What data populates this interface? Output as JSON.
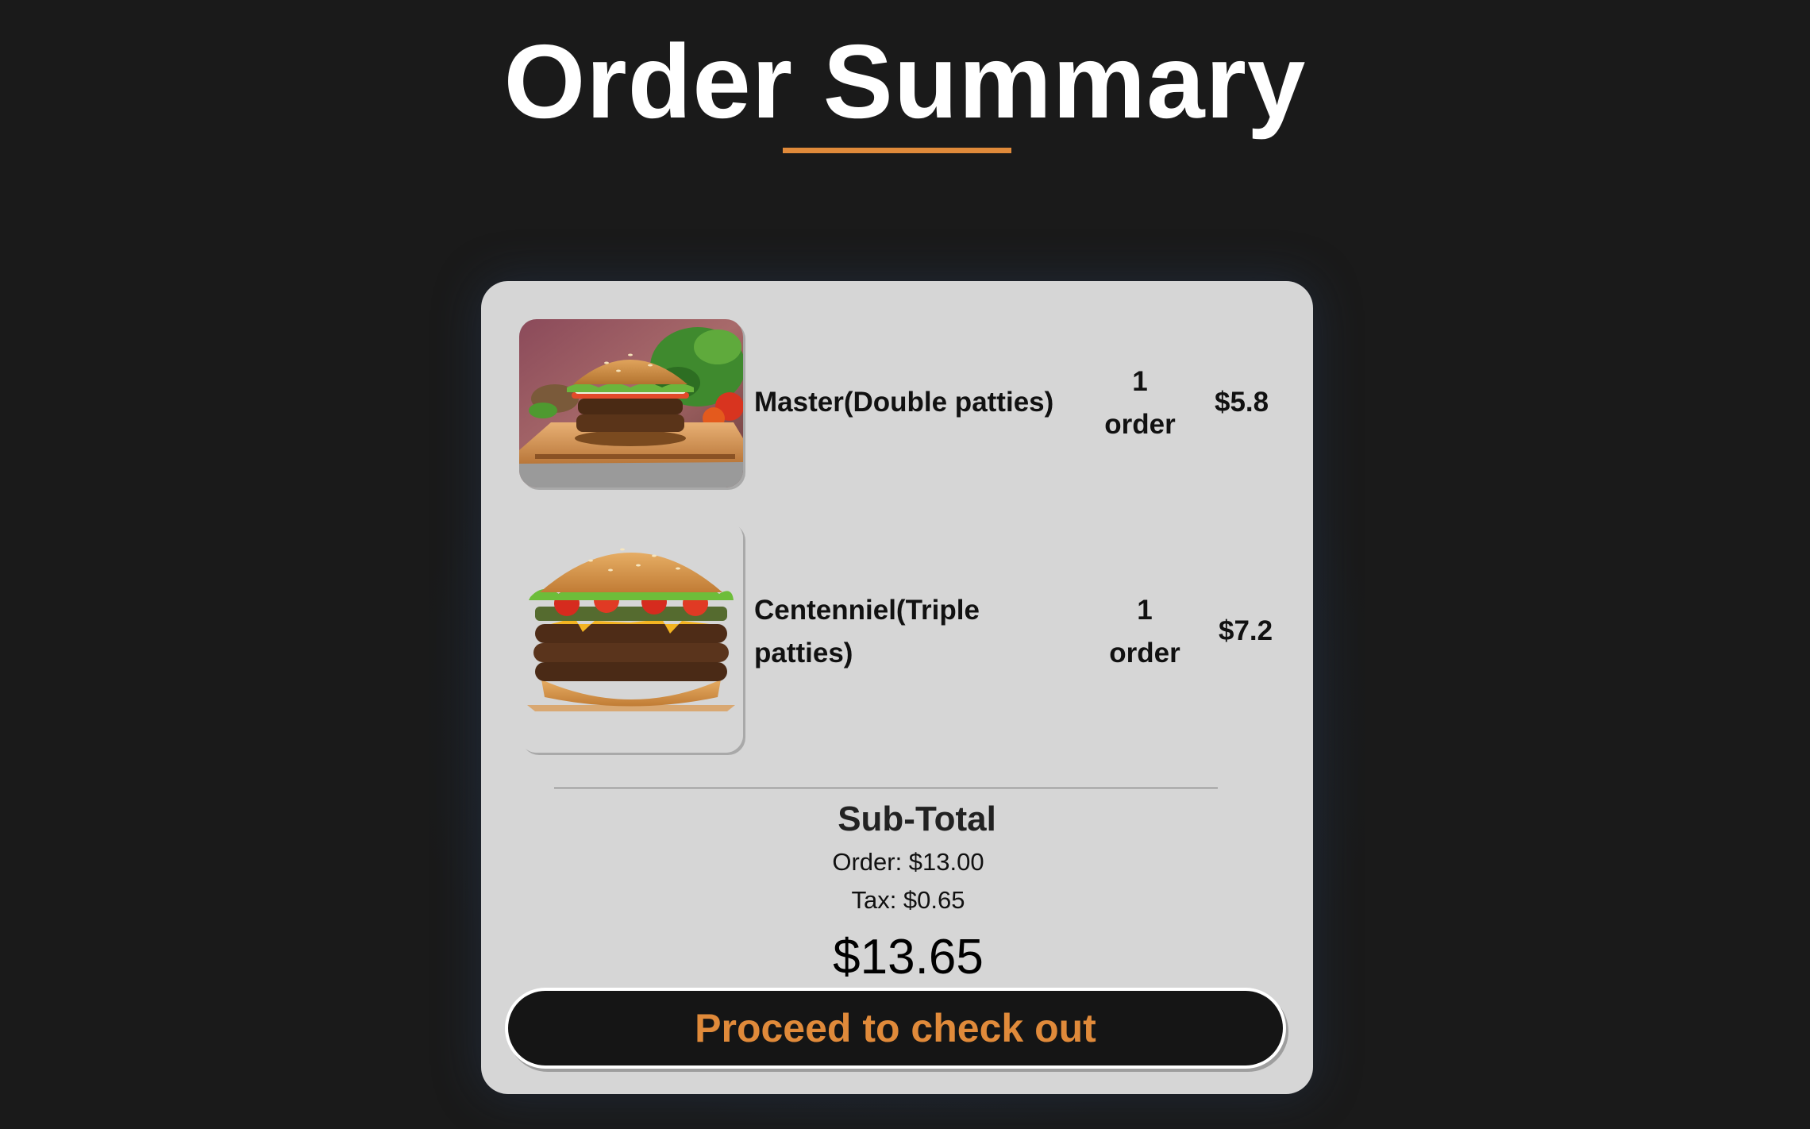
{
  "page": {
    "title": "Order Summary",
    "accent_color": "#e08a3a",
    "background_color": "#1a1a1a",
    "card_color": "#d6d6d6"
  },
  "items": [
    {
      "name": "Master(Double patties)",
      "qty_number": "1",
      "qty_unit": "order",
      "price": "$5.8",
      "image": "burger-double-patty-photo"
    },
    {
      "name": "Centenniel(Triple patties)",
      "qty_number": "1",
      "qty_unit": "order",
      "price": "$7.2",
      "image": "burger-triple-patty-photo"
    }
  ],
  "subtotal": {
    "title": "Sub-Total",
    "order_line": "Order: $13.00",
    "tax_line": "Tax: $0.65",
    "total": "$13.65"
  },
  "checkout": {
    "label": "Proceed to check out"
  }
}
